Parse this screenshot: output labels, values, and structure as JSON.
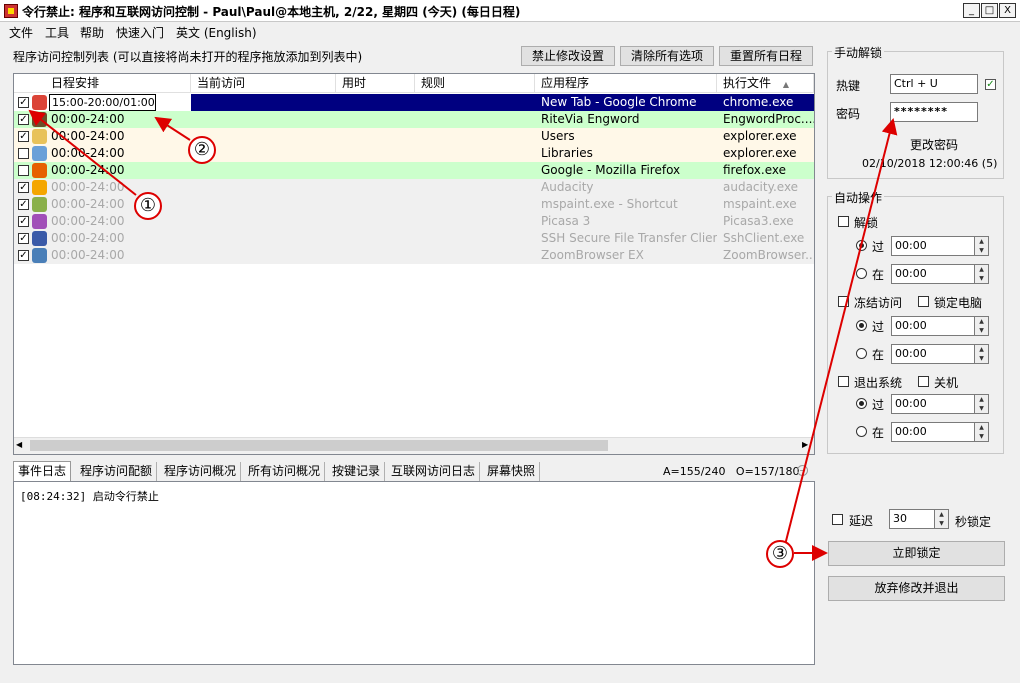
{
  "window": {
    "title": "令行禁止: 程序和互联网访问控制 - Paul\\Paul@本地主机, 2/22, 星期四 (今天) (每日日程)",
    "btn_min": "_",
    "btn_max": "□",
    "btn_close": "X"
  },
  "menu": [
    "文件",
    "工具",
    "帮助",
    "快速入门",
    "英文 (English)"
  ],
  "list_panel": {
    "caption": "程序访问控制列表 (可以直接将尚未打开的程序拖放添加到列表中)",
    "buttons": {
      "disable_edit": "禁止修改设置",
      "clear_all": "清除所有选项",
      "reset_schedule": "重置所有日程"
    },
    "columns": [
      "日程安排",
      "当前访问",
      "用时",
      "规则",
      "应用程序",
      "执行文件"
    ],
    "rows": [
      {
        "checked": true,
        "schedule": "15:00-20:00/01:00",
        "app": "New Tab - Google Chrome",
        "exe": "chrome.exe",
        "style": "selected",
        "icon": "chrome-icon",
        "icon_color": "#db4437"
      },
      {
        "checked": true,
        "schedule": "00:00-24:00",
        "app": "RiteVia Engword",
        "exe": "EngwordProc....",
        "style": "green",
        "icon": "engword-icon",
        "icon_color": "#6b4f2a"
      },
      {
        "checked": true,
        "schedule": "00:00-24:00",
        "app": "Users",
        "exe": "explorer.exe",
        "style": "cream",
        "icon": "folder-icon",
        "icon_color": "#e8c25a"
      },
      {
        "checked": false,
        "schedule": "00:00-24:00",
        "app": "Libraries",
        "exe": "explorer.exe",
        "style": "cream",
        "icon": "libraries-icon",
        "icon_color": "#6aa0d8"
      },
      {
        "checked": false,
        "schedule": "00:00-24:00",
        "app": "Google - Mozilla Firefox",
        "exe": "firefox.exe",
        "style": "green",
        "icon": "firefox-icon",
        "icon_color": "#e66000"
      },
      {
        "checked": true,
        "schedule": "00:00-24:00",
        "app": "Audacity",
        "exe": "audacity.exe",
        "style": "dim",
        "icon": "audacity-icon",
        "icon_color": "#f4a600"
      },
      {
        "checked": true,
        "schedule": "00:00-24:00",
        "app": "mspaint.exe - Shortcut",
        "exe": "mspaint.exe",
        "style": "dim",
        "icon": "paint-icon",
        "icon_color": "#8ab04a"
      },
      {
        "checked": true,
        "schedule": "00:00-24:00",
        "app": "Picasa 3",
        "exe": "Picasa3.exe",
        "style": "dim",
        "icon": "picasa-icon",
        "icon_color": "#a14fb8"
      },
      {
        "checked": true,
        "schedule": "00:00-24:00",
        "app": "SSH Secure File Transfer Client",
        "exe": "SshClient.exe",
        "style": "dim",
        "icon": "ssh-icon",
        "icon_color": "#3a5aa8"
      },
      {
        "checked": true,
        "schedule": "00:00-24:00",
        "app": "ZoomBrowser EX",
        "exe": "ZoomBrowser....",
        "style": "dim",
        "icon": "zoombrowser-icon",
        "icon_color": "#4a7fb8"
      }
    ]
  },
  "tabs": [
    "事件日志",
    "程序访问配额",
    "程序访问概况",
    "所有访问概况",
    "按键记录",
    "互联网访问日志",
    "屏幕快照"
  ],
  "counters": "A=155/240   O=157/180",
  "log": {
    "lines": [
      "[08:24:32] 启动令行禁止"
    ]
  },
  "manual_unlock": {
    "title": "手动解锁",
    "hotkey_label": "热键",
    "hotkey_value": "Ctrl + U",
    "hotkey_checked": true,
    "password_label": "密码",
    "password_value": "********",
    "change_password": "更改密码",
    "timestamp": "02/10/2018 12:00:46 (5)"
  },
  "auto_ops": {
    "title": "自动操作",
    "unlock_label": "解锁",
    "freeze_label": "冻结访问",
    "lock_pc_label": "锁定电脑",
    "logoff_label": "退出系统",
    "shutdown_label": "关机",
    "after_label": "过",
    "at_label": "在",
    "time_value": "00:00"
  },
  "delay": {
    "label": "延迟",
    "value": "30",
    "suffix": "秒锁定"
  },
  "actions": {
    "lock_now": "立即锁定",
    "discard_exit": "放弃修改并退出"
  },
  "annotations": [
    "①",
    "②",
    "③"
  ],
  "colors": {
    "selected": "#000080",
    "green": "#ccffcc",
    "cream": "#fff8e8",
    "dim_bg": "#f0f0f0",
    "annotation": "#dd0000"
  }
}
